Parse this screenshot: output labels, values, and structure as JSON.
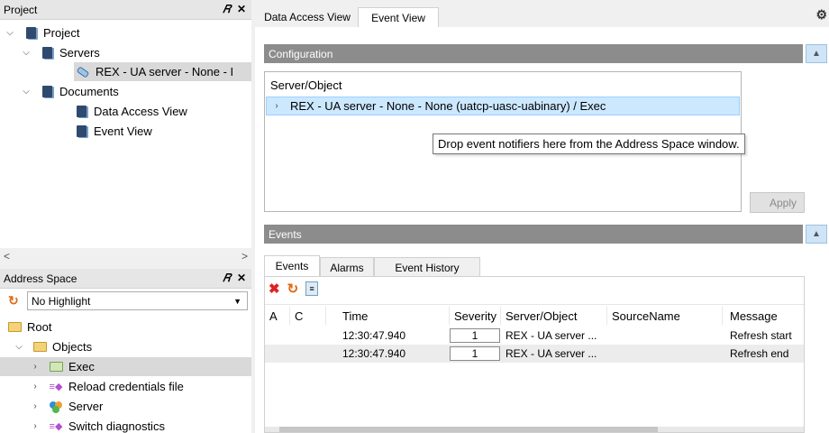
{
  "project_pane": {
    "title": "Project",
    "float_symbol": "ฮ",
    "close_symbol": "✕",
    "tree": [
      {
        "label": "Project",
        "expanded": true
      },
      {
        "label": "Servers",
        "expanded": true
      },
      {
        "label": "REX - UA server - None - I",
        "selected": true
      },
      {
        "label": "Documents",
        "expanded": true
      },
      {
        "label": "Data Access View"
      },
      {
        "label": "Event View"
      }
    ],
    "scroll_left": "<",
    "scroll_right": ">"
  },
  "address_pane": {
    "title": "Address Space",
    "float_symbol": "ฮ",
    "close_symbol": "✕",
    "highlight_combo": "No Highlight",
    "tree": [
      {
        "label": "Root"
      },
      {
        "label": "Objects",
        "expanded": true
      },
      {
        "label": "Exec",
        "selected": true
      },
      {
        "label": "Reload credentials file"
      },
      {
        "label": "Server"
      },
      {
        "label": "Switch diagnostics"
      }
    ]
  },
  "doc_tabs": [
    {
      "label": "Data Access View",
      "active": false
    },
    {
      "label": "Event View",
      "active": true
    }
  ],
  "configuration": {
    "title": "Configuration",
    "column_label": "Server/Object",
    "row": "REX - UA server - None - None (uatcp-uasc-uabinary) / Exec",
    "tooltip": "Drop event notifiers here from the Address Space window.",
    "apply_label": "Apply"
  },
  "events": {
    "title": "Events",
    "tabs": [
      "Events",
      "Alarms",
      "Event History"
    ],
    "columns": [
      "A",
      "C",
      "Time",
      "Severity",
      "Server/Object",
      "SourceName",
      "Message"
    ],
    "rows": [
      {
        "a": "",
        "c": "",
        "time": "12:30:47.940",
        "severity": "1",
        "server": "REX - UA server ...",
        "source": "",
        "message": "Refresh start"
      },
      {
        "a": "",
        "c": "",
        "time": "12:30:47.940",
        "severity": "1",
        "server": "REX - UA server ...",
        "source": "",
        "message": "Refresh end"
      }
    ]
  },
  "colors": {
    "selection": "#cce8ff",
    "section_bar": "#8c8c8c",
    "pane_header": "#e6e6e6"
  }
}
